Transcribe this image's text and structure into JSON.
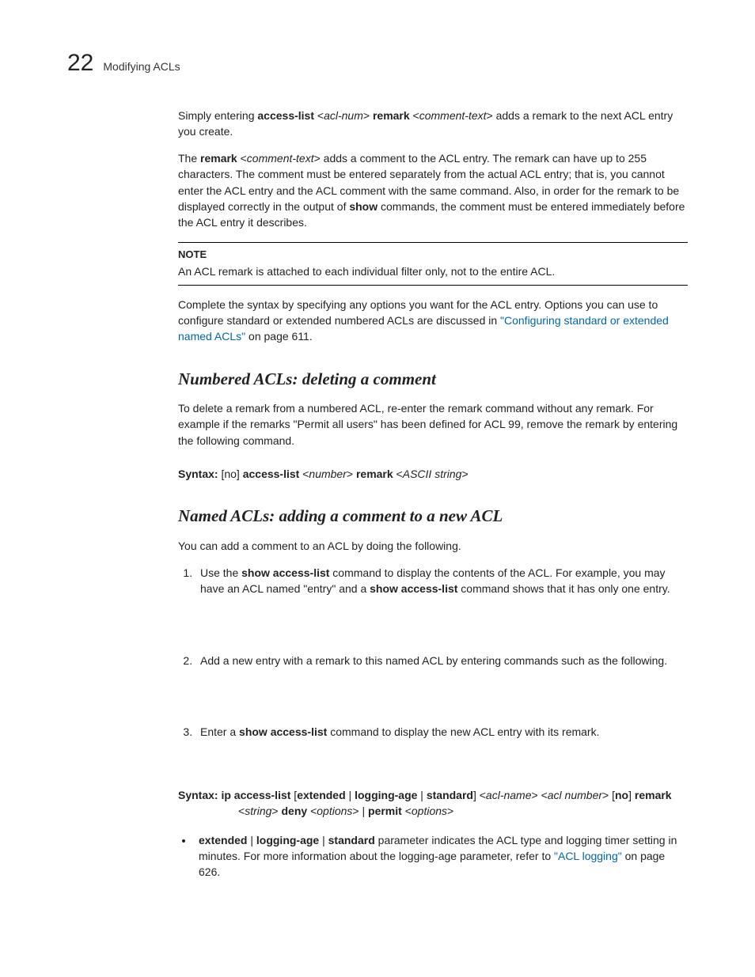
{
  "header": {
    "chapter_number": "22",
    "chapter_title": "Modifying ACLs"
  },
  "intro": {
    "p1_a": "Simply entering ",
    "p1_b": "access-list",
    "p1_c": " <",
    "p1_d": "acl-num",
    "p1_e": "> ",
    "p1_f": "remark",
    "p1_g": " <",
    "p1_h": "comment-text",
    "p1_i": "> adds a remark to the next ACL entry you create.",
    "p2_a": "The ",
    "p2_b": "remark",
    "p2_c": " <",
    "p2_d": "comment-text",
    "p2_e": "> adds a comment to the ACL entry. The remark can have up to 255 characters. The comment must be entered separately from the actual ACL entry; that is, you cannot enter the ACL entry and the ACL comment with the same command. Also, in order for the remark to be displayed correctly in the output of ",
    "p2_f": "show",
    "p2_g": " commands, the comment must be entered immediately before the ACL entry it describes."
  },
  "note": {
    "label": "NOTE",
    "text": "An ACL remark is attached to each individual filter only, not to the entire ACL."
  },
  "p3": {
    "a": "Complete the syntax by specifying any options you want for the ACL entry. Options you can use to configure standard or extended numbered ACLs are discussed in ",
    "link": "\"Configuring standard or extended named ACLs\"",
    "b": " on page 611."
  },
  "sec1": {
    "heading": "Numbered ACLs: deleting a comment",
    "p1": "To delete a remark from a numbered ACL, re-enter the remark command without any remark. For example if the remarks \"Permit all users\" has been defined for ACL 99, remove the remark by entering the following command.",
    "syntax_label": "Syntax:  ",
    "s1": "[no] ",
    "s2": "access-list",
    "s3": " <",
    "s4": "number",
    "s5": "> ",
    "s6": "remark",
    "s7": " <",
    "s8": "ASCII string",
    "s9": ">"
  },
  "sec2": {
    "heading": "Named ACLs: adding a comment to a new ACL",
    "intro": "You can add a comment to an ACL by doing the following.",
    "step1_a": "Use the ",
    "step1_b": "show access-list",
    "step1_c": " command to display the contents of the ACL. For example, you may have an ACL named \"entry\" and a ",
    "step1_d": "show access-list",
    "step1_e": " command shows that it has only one entry.",
    "step2": "Add a new entry with a remark to this named ACL by entering commands such as the following.",
    "step3_a": "Enter a ",
    "step3_b": "show access-list",
    "step3_c": " command to display the new ACL entry with its remark.",
    "syntax_label": "Syntax:  ",
    "sx1": "ip access-list ",
    "sx2": "[",
    "sx3": "extended",
    "sx4": " | ",
    "sx5": "logging-age",
    "sx6": " | ",
    "sx7": "standard",
    "sx8": "] <",
    "sx9": "acl-name",
    "sx10": "> <",
    "sx11": "acl number",
    "sx12": "> [",
    "sx13": "no",
    "sx14": "] ",
    "sx15": "remark",
    "sx16": "<",
    "sx17": "string",
    "sx18": "> ",
    "sx19": "deny",
    "sx20": " <",
    "sx21": "options",
    "sx22": "> | ",
    "sx23": "permit",
    "sx24": " <",
    "sx25": "options",
    "sx26": ">",
    "bullet1_a": "extended",
    "bullet1_b": " | ",
    "bullet1_c": "logging-age",
    "bullet1_d": " | ",
    "bullet1_e": "standard",
    "bullet1_f": " parameter indicates the ACL type and logging timer setting in minutes. For more information about the logging-age parameter, refer to ",
    "bullet1_link": "\"ACL logging\"",
    "bullet1_g": " on page 626."
  }
}
